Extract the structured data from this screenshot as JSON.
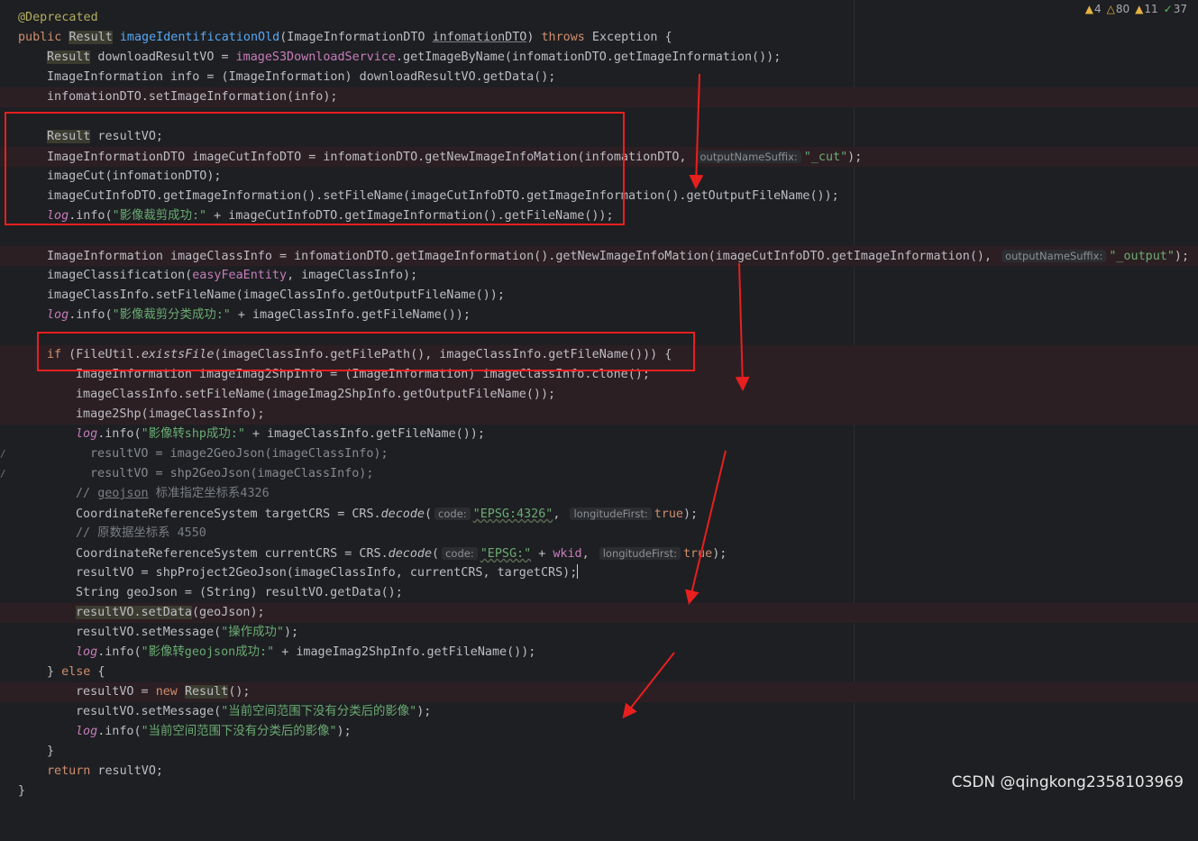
{
  "indicators": {
    "warnings": "4",
    "weak_warnings": "80",
    "typos": "11",
    "ok": "37"
  },
  "watermark": "CSDN @qingkong2358103969",
  "colors": {
    "annotation_box": "#e81f1f",
    "arrow": "#e81f1f"
  },
  "code": {
    "l1": {
      "annotation": "@Deprecated"
    },
    "l2": {
      "kw_public": "public ",
      "type": "Result",
      "name": "imageIdentificationOld",
      "params_a": "(ImageInformationDTO ",
      "param": "infomationDTO",
      "params_b": ") ",
      "kw_throws": "throws",
      "tail": " Exception {"
    },
    "l3": {
      "type": "Result",
      "a": " downloadResultVO = ",
      "field": "imageS3DownloadService",
      "b": ".getImageByName(infomationDTO.getImageInformation());"
    },
    "l4": {
      "text": "ImageInformation info = (ImageInformation) downloadResultVO.getData();"
    },
    "l5": {
      "text": "infomationDTO.setImageInformation(info);"
    },
    "l7": {
      "type": "Result",
      "a": " resultVO;"
    },
    "l8": {
      "a": "ImageInformationDTO imageCutInfoDTO = infomationDTO.getNewImageInfoMation(infomationDTO, ",
      "hint": "outputNameSuffix:",
      "str": "\"_cut\"",
      "b": ");"
    },
    "l9": {
      "text": "imageCut(infomationDTO);"
    },
    "l10": {
      "text": "imageCutInfoDTO.getImageInformation().setFileName(imageCutInfoDTO.getImageInformation().getOutputFileName());"
    },
    "l11": {
      "log": "log",
      "a": ".info(",
      "str": "\"影像裁剪成功:\"",
      "b": " + imageCutInfoDTO.getImageInformation().getFileName());"
    },
    "l13": {
      "a": "ImageInformation imageClassInfo = infomationDTO.getImageInformation().getNewImageInfoMation(imageCutInfoDTO.getImageInformation(), ",
      "hint": "outputNameSuffix:",
      "str": "\"_output\"",
      "b": ");"
    },
    "l14": {
      "a": "imageClassification(",
      "field": "easyFeaEntity",
      "b": ", imageClassInfo);"
    },
    "l15": {
      "text": "imageClassInfo.setFileName(imageClassInfo.getOutputFileName());"
    },
    "l16": {
      "log": "log",
      "a": ".info(",
      "str": "\"影像裁剪分类成功:\"",
      "b": " + imageClassInfo.getFileName());"
    },
    "l18": {
      "kw": "if",
      "a": " (FileUtil.",
      "static": "existsFile",
      "b": "(imageClassInfo.getFilePath(), imageClassInfo.getFileName())) {"
    },
    "l19": {
      "text": "ImageInformation imageImag2ShpInfo = (ImageInformation) imageClassInfo.clone();"
    },
    "l20": {
      "text": "imageClassInfo.setFileName(imageImag2ShpInfo.getOutputFileName());"
    },
    "l21": {
      "text": "image2Shp(imageClassInfo);"
    },
    "l22": {
      "log": "log",
      "a": ".info(",
      "str": "\"影像转shp成功:\"",
      "b": " + imageClassInfo.getFileName());"
    },
    "l23": {
      "text": "resultVO = image2GeoJson(imageClassInfo);"
    },
    "l24": {
      "text": "resultVO = shp2GeoJson(imageClassInfo);"
    },
    "l25": {
      "a": "// ",
      "u": "geojson",
      "b": " 标准指定坐标系4326"
    },
    "l26": {
      "a": "CoordinateReferenceSystem targetCRS = CRS.",
      "static": "decode",
      "b": "(",
      "hint1": "code:",
      "str": "\"EPSG:4326\"",
      "c": ", ",
      "hint2": "longitudeFirst:",
      "kw": "true",
      "d": ");"
    },
    "l27": {
      "text": "// 原数据坐标系 4550"
    },
    "l28": {
      "a": "CoordinateReferenceSystem currentCRS = CRS.",
      "static": "decode",
      "b": "(",
      "hint1": "code:",
      "str": "\"EPSG:\"",
      "c": " + ",
      "field": "wkid",
      "d": ", ",
      "hint2": "longitudeFirst:",
      "kw": "true",
      "e": ");"
    },
    "l29": {
      "text": "resultVO = shpProject2GeoJson(imageClassInfo, currentCRS, targetCRS);"
    },
    "l30": {
      "text": "String geoJson = (String) resultVO.getData();"
    },
    "l31": {
      "hl": "resultVO.setData",
      "b": "(geoJson);"
    },
    "l32": {
      "a": "resultVO.setMessage(",
      "str": "\"操作成功\"",
      "b": ");"
    },
    "l33": {
      "log": "log",
      "a": ".info(",
      "str": "\"影像转geojson成功:\"",
      "b": " + imageImag2ShpInfo.getFileName());"
    },
    "l34": {
      "a": "} ",
      "kw": "else",
      "b": " {"
    },
    "l35": {
      "a": "resultVO = ",
      "kw": "new",
      "sp": " ",
      "type": "Result",
      "b": "();"
    },
    "l36": {
      "a": "resultVO.setMessage(",
      "str": "\"当前空间范围下没有分类后的影像\"",
      "b": ");"
    },
    "l37": {
      "log": "log",
      "a": ".info(",
      "str": "\"当前空间范围下没有分类后的影像\"",
      "b": ");"
    },
    "l38": {
      "text": "}"
    },
    "l39": {
      "kw": "return",
      "a": " resultVO;"
    },
    "l40": {
      "text": "}"
    }
  }
}
